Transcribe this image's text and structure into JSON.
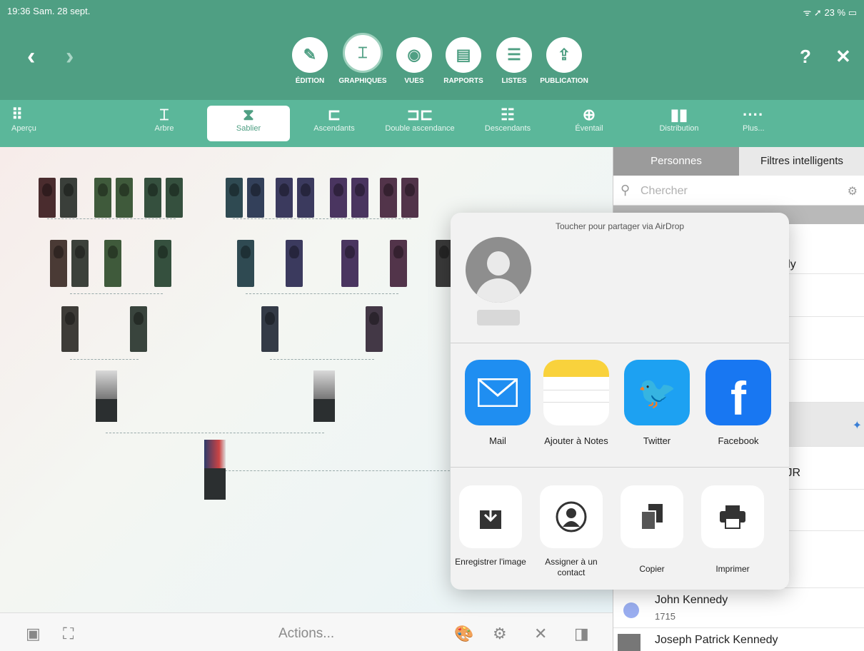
{
  "status": {
    "time": "19:36",
    "date": "Sam. 28 sept.",
    "battery": "23 %"
  },
  "nav": {
    "back_icon": "chevron-left-icon",
    "forward_icon": "chevron-right-icon",
    "help": "?",
    "close": "✕"
  },
  "modes": [
    {
      "label": "ÉDITION",
      "icon": "pencil-icon"
    },
    {
      "label": "GRAPHIQUES",
      "icon": "chart-icon"
    },
    {
      "label": "VUES",
      "icon": "eye-icon"
    },
    {
      "label": "RAPPORTS",
      "icon": "document-icon"
    },
    {
      "label": "LISTES",
      "icon": "list-icon"
    },
    {
      "label": "PUBLICATION",
      "icon": "upload-icon"
    }
  ],
  "chart_tabs": [
    {
      "label": "Aperçu",
      "icon": "grid-icon"
    },
    {
      "label": "Arbre",
      "icon": "tree-icon"
    },
    {
      "label": "Sablier",
      "icon": "hourglass-icon"
    },
    {
      "label": "Ascendants",
      "icon": "ancestors-icon"
    },
    {
      "label": "Double ascendance",
      "icon": "double-ancestry-icon"
    },
    {
      "label": "Descendants",
      "icon": "descendants-icon"
    },
    {
      "label": "Éventail",
      "icon": "fan-icon"
    },
    {
      "label": "Distribution",
      "icon": "distribution-icon"
    },
    {
      "label": "Plus...",
      "icon": "more-icon"
    }
  ],
  "active_chart_tab": "Sablier",
  "bottom": {
    "actions_label": "Actions..."
  },
  "panel": {
    "tab_persons": "Personnes",
    "tab_filters": "Filtres intelligents",
    "search_placeholder": "Chercher",
    "partial_rows": [
      "edy",
      "y",
      "y JR",
      "d"
    ],
    "persons": [
      {
        "name": "John Kennedy",
        "year": "1715"
      },
      {
        "name": "Joseph Patrick Kennedy",
        "year": ""
      }
    ]
  },
  "share": {
    "airdrop": "Toucher pour partager via AirDrop",
    "apps": [
      {
        "label": "Mail",
        "icon": "mail-icon"
      },
      {
        "label": "Ajouter à Notes",
        "icon": "notes-icon"
      },
      {
        "label": "Twitter",
        "icon": "twitter-icon"
      },
      {
        "label": "Facebook",
        "icon": "facebook-icon"
      }
    ],
    "actions": [
      {
        "label": "Enregistrer l'image",
        "icon": "save-image-icon"
      },
      {
        "label": "Assigner à un contact",
        "icon": "assign-contact-icon"
      },
      {
        "label": "Copier",
        "icon": "copy-icon"
      },
      {
        "label": "Imprimer",
        "icon": "print-icon"
      }
    ]
  },
  "colors": {
    "header": "#4f9f83",
    "subbar": "#5bb79a",
    "panel_tab_active": "#9b9b9b"
  }
}
